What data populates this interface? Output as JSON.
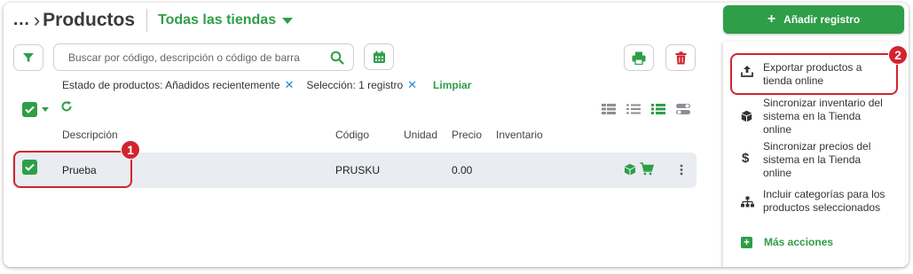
{
  "header": {
    "breadcrumb_dots": "...",
    "title": "Productos",
    "store_selector": "Todas las tiendas"
  },
  "search": {
    "placeholder": "Buscar por código, descripción o código de barra"
  },
  "filters": {
    "chips": [
      {
        "label": "Estado de productos: Añadidos recientemente"
      },
      {
        "label": "Selección: 1 registro"
      }
    ],
    "clear_label": "Limpiar"
  },
  "table": {
    "columns": [
      "Descripción",
      "Código",
      "Unidad",
      "Precio",
      "Inventario"
    ],
    "rows": [
      {
        "description": "Prueba",
        "code": "PRUSKU",
        "unit": "",
        "price": "0.00",
        "inventory": ""
      }
    ]
  },
  "sidebar": {
    "add_button_label": "Añadir registro",
    "menu_items": [
      {
        "label_line1": "Exportar productos a",
        "label_line2": "tienda online",
        "icon": "upload-icon"
      },
      {
        "label_line1": "Sincronizar inventario del",
        "label_line2": "sistema en la Tienda",
        "label_line3": "online",
        "icon": "box-icon"
      },
      {
        "label_line1": "Sincronizar precios del",
        "label_line2": "sistema en la Tienda",
        "label_line3": "online",
        "icon": "dollar-icon"
      },
      {
        "label_line1": "Incluir categorías para los",
        "label_line2": "productos seleccionados",
        "icon": "hierarchy-icon"
      }
    ],
    "more_actions_label": "Más acciones"
  },
  "callouts": [
    {
      "number": "1"
    },
    {
      "number": "2"
    }
  ],
  "colors": {
    "accent_green": "#2e9e48",
    "danger_red": "#d32330",
    "callout_red": "#d32330",
    "link_blue": "#1e8ad6",
    "row_bg": "#e9ecf0"
  }
}
